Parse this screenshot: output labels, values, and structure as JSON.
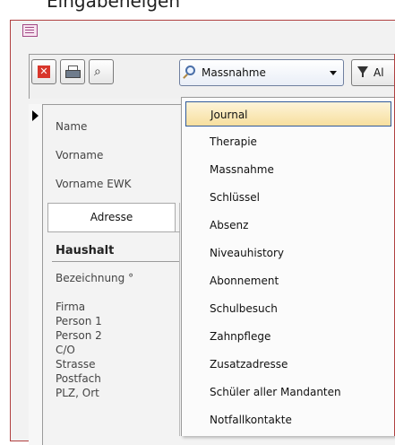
{
  "header_fragment": "Eingabeneigen",
  "toolbar": {
    "combo_value": "Massnahme",
    "filter_label": "Al"
  },
  "form": {
    "labels": [
      "Name",
      "Vorname",
      "Vorname EWK"
    ],
    "tab_label": "Adresse",
    "section_title": "Haushalt",
    "section_labels": [
      "Bezeichnung °",
      "Firma",
      "Person 1",
      "Person 2",
      "C/O",
      "Strasse",
      "Postfach",
      "PLZ,  Ort"
    ]
  },
  "dropdown": {
    "items": [
      "Journal",
      "Therapie",
      "Massnahme",
      "Schlüssel",
      "Absenz",
      "Niveauhistory",
      "Abonnement",
      "Schulbesuch",
      "Zahnpflege",
      "Zusatzadresse",
      "Schüler aller Mandanten",
      "Notfallkontakte"
    ],
    "selected": "Journal"
  },
  "colors": {
    "window_border": "#b04040",
    "selected_item_bg": "#f7df9e",
    "selected_item_border": "#315a9a",
    "close_icon": "#d8362b"
  },
  "icons": [
    "form-icon",
    "close-icon",
    "print-icon",
    "find-icon",
    "magnifier-icon",
    "filter-icon"
  ]
}
